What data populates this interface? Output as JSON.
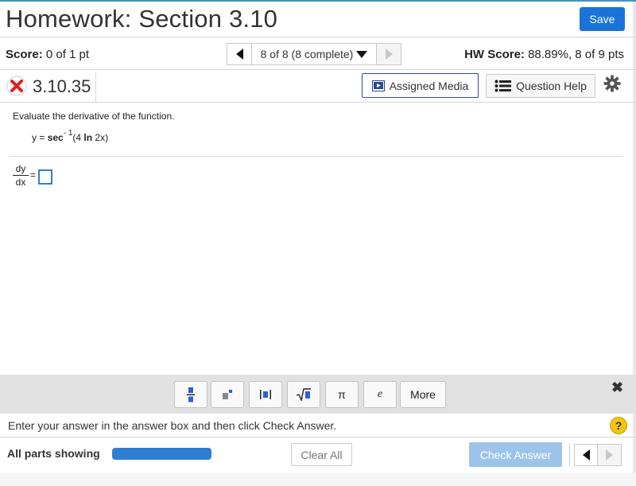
{
  "header": {
    "title": "Homework: Section 3.10",
    "save_label": "Save"
  },
  "score_row": {
    "score_label": "Score:",
    "score_value": "0 of 1 pt",
    "nav_label": "8 of 8 (8 complete)",
    "hw_score_label": "HW Score:",
    "hw_score_value": "88.89%, 8 of 9 pts"
  },
  "question": {
    "number": "3.10.35",
    "status": "incorrect",
    "assigned_media_label": "Assigned Media",
    "question_help_label": "Question Help",
    "prompt": "Evaluate the derivative of the function.",
    "function_lhs": "y = ",
    "function_sec": "sec",
    "function_exp": "- 1",
    "function_arg_open": "(4 ",
    "function_ln": "ln",
    "function_arg_close": " 2x)",
    "deriv_num": "dy",
    "deriv_den": "dx",
    "equals": "=",
    "answer_value": ""
  },
  "math_toolbar": {
    "buttons": [
      {
        "name": "fraction-icon",
        "label": ""
      },
      {
        "name": "exponent-icon",
        "label": ""
      },
      {
        "name": "absolute-value-icon",
        "label": ""
      },
      {
        "name": "square-root-icon",
        "label": ""
      },
      {
        "name": "pi",
        "label": "π"
      },
      {
        "name": "e",
        "label": "e"
      },
      {
        "name": "more",
        "label": "More"
      }
    ],
    "close_label": "✖"
  },
  "info": {
    "instruction": "Enter your answer in the answer box and then click Check Answer.",
    "help_glyph": "?"
  },
  "bottom": {
    "parts_label": "All parts showing",
    "progress": 1.0,
    "clear_label": "Clear All",
    "check_label": "Check Answer"
  },
  "colors": {
    "primary": "#1a73d9",
    "check_disabled": "#9cc4ea",
    "progress": "#2f7fd0",
    "error": "#e02020",
    "help_badge": "#f2c40f"
  }
}
